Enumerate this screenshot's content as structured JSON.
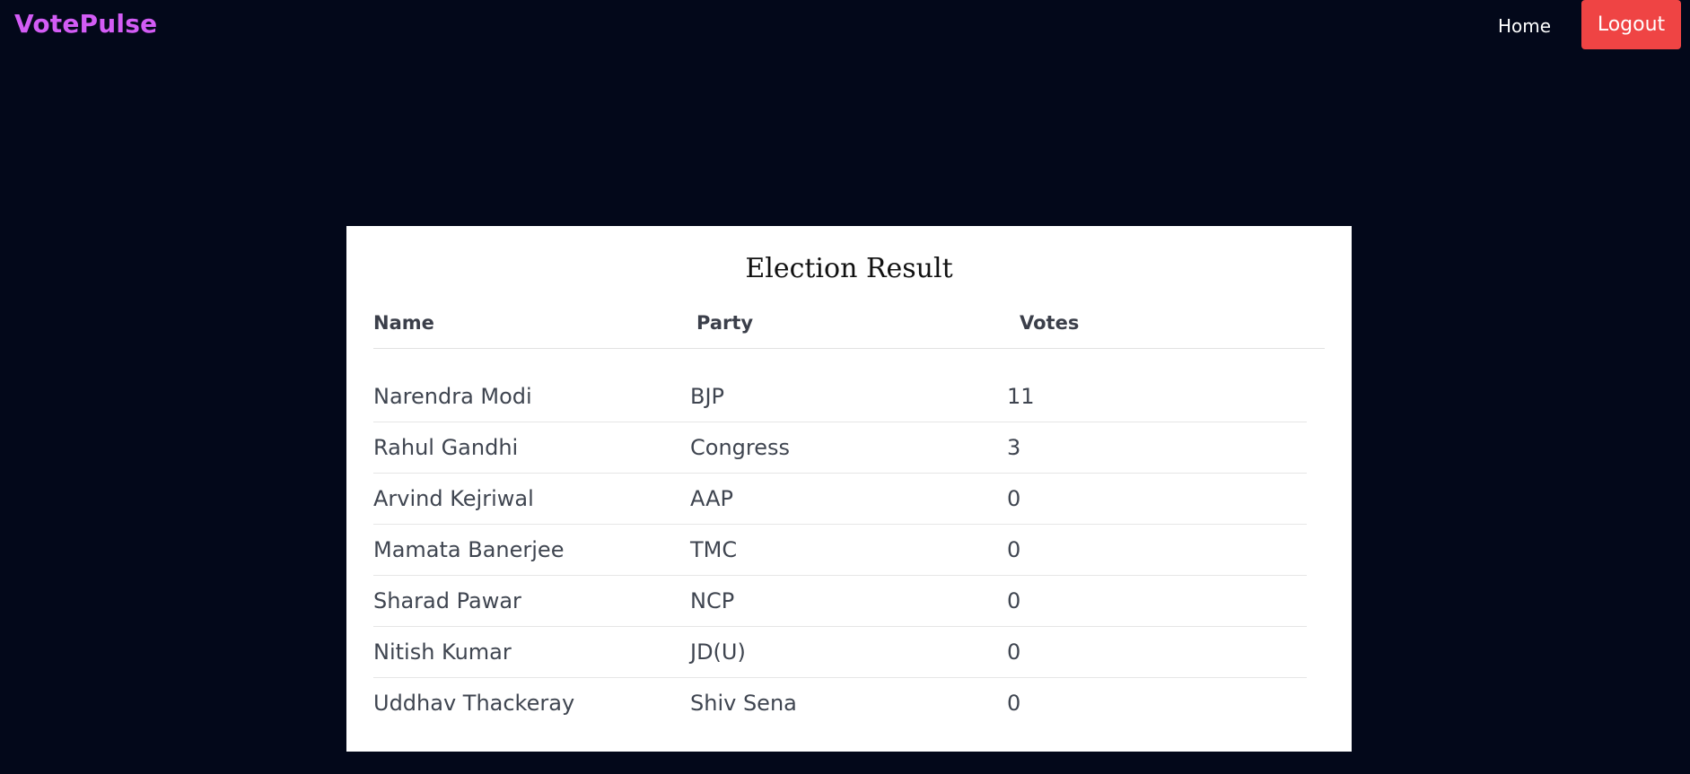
{
  "navbar": {
    "brand": "VotePulse",
    "home_label": "Home",
    "logout_label": "Logout"
  },
  "results": {
    "title": "Election Result",
    "columns": [
      "Name",
      "Party",
      "Votes"
    ],
    "rows": [
      {
        "name": "Narendra Modi",
        "party": "BJP",
        "votes": "11"
      },
      {
        "name": "Rahul Gandhi",
        "party": "Congress",
        "votes": "3"
      },
      {
        "name": "Arvind Kejriwal",
        "party": "AAP",
        "votes": "0"
      },
      {
        "name": "Mamata Banerjee",
        "party": "TMC",
        "votes": "0"
      },
      {
        "name": "Sharad Pawar",
        "party": "NCP",
        "votes": "0"
      },
      {
        "name": "Nitish Kumar",
        "party": "JD(U)",
        "votes": "0"
      },
      {
        "name": "Uddhav Thackeray",
        "party": "Shiv Sena",
        "votes": "0"
      }
    ]
  },
  "icons": {
    "scroll_up": "scroll-up-arrow-icon",
    "scroll_down": "scroll-down-arrow-icon"
  },
  "colors": {
    "background": "#03081a",
    "brand": "#d35cf5",
    "logout": "#ef4444",
    "card": "#ffffff"
  }
}
